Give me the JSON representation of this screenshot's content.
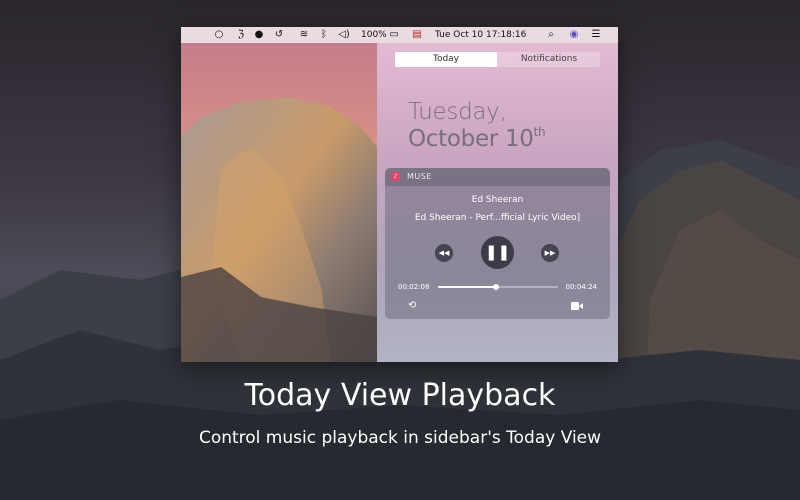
{
  "menubar": {
    "battery_percent": "100%",
    "date_time": "Tue Oct 10  17:18:16",
    "icons": [
      "circle-icon",
      "app-icon",
      "muse-icon",
      "time-machine-icon",
      "wifi-icon",
      "bluetooth-icon",
      "volume-icon",
      "battery-icon",
      "flag-icon",
      "search-icon",
      "siri-icon",
      "notification-center-icon"
    ]
  },
  "notification_center": {
    "tabs": [
      {
        "label": "Today",
        "active": true
      },
      {
        "label": "Notifications",
        "active": false
      }
    ],
    "date_line1": "Tuesday,",
    "date_line2": "October 10",
    "date_suffix": "th"
  },
  "widget": {
    "app_name": "MUSE",
    "artist": "Ed Sheeran",
    "song": "Ed Sheeran - Perf...fficial Lyric Video]",
    "elapsed": "00:02:08",
    "total": "00:04:24",
    "progress": 0.485
  },
  "caption": {
    "title": "Today View Playback",
    "subtitle": "Control music playback in sidebar's Today View"
  },
  "colors": {
    "muse_accent": "#e0486a",
    "widget_bg": "#6e6e7d"
  }
}
